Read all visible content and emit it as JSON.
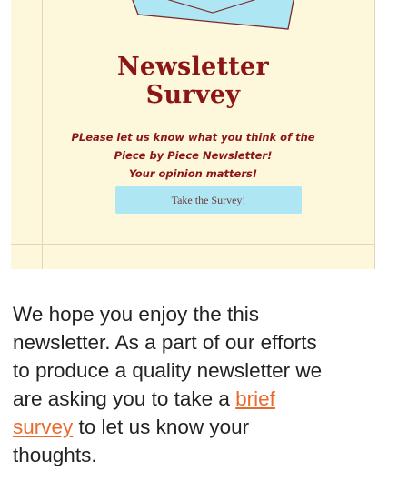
{
  "banner": {
    "title_line1": "Newsletter",
    "title_line2": "Survey",
    "blurb_line1": "PLease let us know what you think of the",
    "blurb_line2": "Piece by Piece Newsletter!",
    "blurb_line3": "Your opinion matters!",
    "button_label": "Take the Survey!",
    "colors": {
      "background": "#fdf8dc",
      "title": "#8c1616",
      "button": "#aee6f3",
      "envelope": "#aee6f3"
    }
  },
  "body": {
    "line1": "We hope you enjoy the this",
    "line2": "newsletter. As a part of our efforts",
    "line3": "to produce a quality newsletter we",
    "line4_prefix": "are asking you to take a ",
    "link_part1": "brief",
    "link_part2": "survey",
    "line5_suffix": " to let us know your",
    "line6": "thoughts.",
    "link_color": "#e86a2c"
  },
  "icons": {
    "envelope": "envelope-icon"
  }
}
